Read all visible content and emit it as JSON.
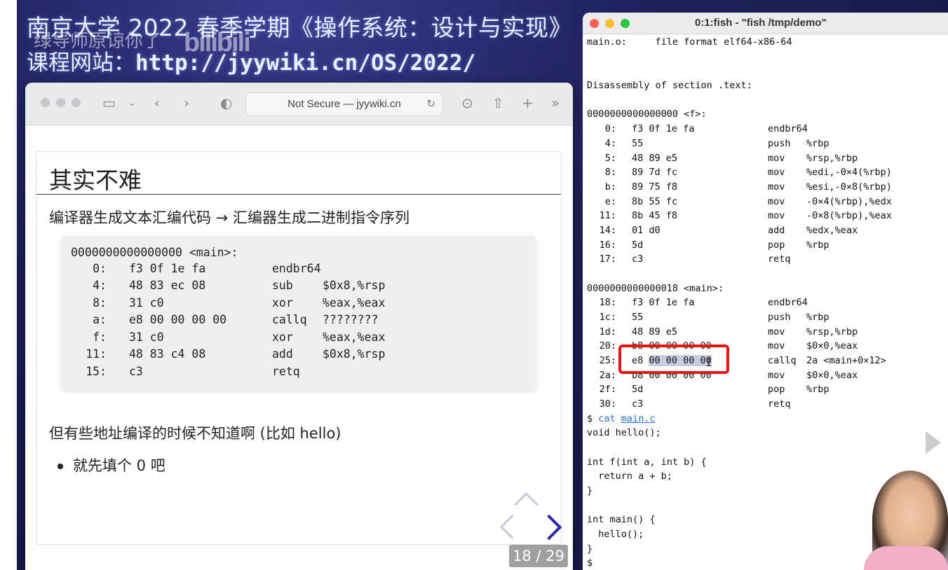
{
  "video": {
    "title": "南京大学 2022 春季学期《操作系统：设计与实现》",
    "url_prefix": "课程网站：",
    "url": "http://jyywiki.cn/OS/2022/",
    "comment": "绿导师原谅你了",
    "watermark": "bilibili"
  },
  "browser": {
    "address": "Not Secure — jyywiki.cn",
    "icons": [
      "sidebar-icon",
      "chevron-down-icon",
      "back-icon",
      "forward-icon",
      "shield-icon",
      "translate-icon",
      "reload-icon",
      "download-icon",
      "share-icon",
      "new-tab-icon",
      "more-icon"
    ]
  },
  "slide": {
    "title": "其实不难",
    "line1": "编译器生成文本汇编代码 → 汇编器生成二进制指令序列",
    "code_header": "0000000000000000 <main>:",
    "code": [
      {
        "addr": "0:",
        "bytes": "f3 0f 1e fa",
        "op": "endbr64",
        "arg": ""
      },
      {
        "addr": "4:",
        "bytes": "48 83 ec 08",
        "op": "sub",
        "arg": "$0x8,%rsp"
      },
      {
        "addr": "8:",
        "bytes": "31 c0",
        "op": "xor",
        "arg": "%eax,%eax"
      },
      {
        "addr": "a:",
        "bytes": "e8 00 00 00 00",
        "op": "callq",
        "arg": "????????"
      },
      {
        "addr": "f:",
        "bytes": "31 c0",
        "op": "xor",
        "arg": "%eax,%eax"
      },
      {
        "addr": "11:",
        "bytes": "48 83 c4 08",
        "op": "add",
        "arg": "$0x8,%rsp"
      },
      {
        "addr": "15:",
        "bytes": "c3",
        "op": "retq",
        "arg": ""
      }
    ],
    "question": "但有些地址编译的时候不知道啊 (比如 hello)",
    "bullet": "就先填个 0 吧",
    "counter": "18 / 29"
  },
  "terminal": {
    "title": "0:1:fish - \"fish /tmp/demo\"",
    "header": "main.o:     file format elf64-x86-64",
    "section": "Disassembly of section .text:",
    "f_label": "0000000000000000 <f>:",
    "f_rows": [
      {
        "addr": "0:",
        "bytes": "f3 0f 1e fa",
        "op": "endbr64",
        "arg": ""
      },
      {
        "addr": "4:",
        "bytes": "55",
        "op": "push",
        "arg": "%rbp"
      },
      {
        "addr": "5:",
        "bytes": "48 89 e5",
        "op": "mov",
        "arg": "%rsp,%rbp"
      },
      {
        "addr": "8:",
        "bytes": "89 7d fc",
        "op": "mov",
        "arg": "%edi,-0×4(%rbp)"
      },
      {
        "addr": "b:",
        "bytes": "89 75 f8",
        "op": "mov",
        "arg": "%esi,-0×8(%rbp)"
      },
      {
        "addr": "e:",
        "bytes": "8b 55 fc",
        "op": "mov",
        "arg": "-0×4(%rbp),%edx"
      },
      {
        "addr": "11:",
        "bytes": "8b 45 f8",
        "op": "mov",
        "arg": "-0×8(%rbp),%eax"
      },
      {
        "addr": "14:",
        "bytes": "01 d0",
        "op": "add",
        "arg": "%edx,%eax"
      },
      {
        "addr": "16:",
        "bytes": "5d",
        "op": "pop",
        "arg": "%rbp"
      },
      {
        "addr": "17:",
        "bytes": "c3",
        "op": "retq",
        "arg": ""
      }
    ],
    "main_label": "0000000000000018 <main>:",
    "main_rows": [
      {
        "addr": "18:",
        "bytes": "f3 0f 1e fa",
        "op": "endbr64",
        "arg": ""
      },
      {
        "addr": "1c:",
        "bytes": "55",
        "op": "push",
        "arg": "%rbp"
      },
      {
        "addr": "1d:",
        "bytes": "48 89 e5",
        "op": "mov",
        "arg": "%rsp,%rbp"
      },
      {
        "addr": "20:",
        "bytes": "b8 00 00 00 00",
        "op": "mov",
        "arg": "$0×0,%eax"
      },
      {
        "addr": "25:",
        "bytes_pre": "e8 ",
        "bytes_hl": "00 00 00 00",
        "op": "callq",
        "arg": "2a <main+0×12>"
      },
      {
        "addr": "2a:",
        "bytes": "b8 00 00 00 00",
        "op": "mov",
        "arg": "$0×0,%eax"
      },
      {
        "addr": "2f:",
        "bytes": "5d",
        "op": "pop",
        "arg": "%rbp"
      },
      {
        "addr": "30:",
        "bytes": "c3",
        "op": "retq",
        "arg": ""
      }
    ],
    "prompt": "$ ",
    "cmd": "cat",
    "file": "main.c",
    "source": [
      "void hello();",
      "",
      "int f(int a, int b) {",
      "  return a + b;",
      "}",
      "",
      "int main() {",
      "  hello();",
      "}"
    ],
    "final_prompt": "$"
  }
}
